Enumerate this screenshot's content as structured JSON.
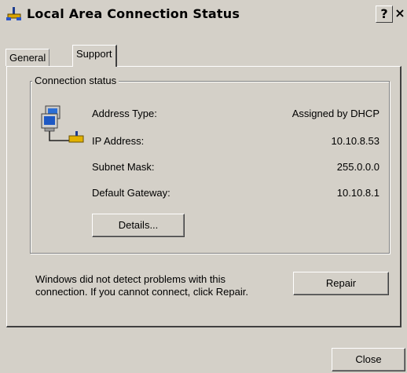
{
  "window": {
    "title": "Local Area Connection Status",
    "help_button": "?",
    "close_button": "×"
  },
  "tabs": [
    {
      "label": "General",
      "selected": false
    },
    {
      "label": "Support",
      "selected": true
    }
  ],
  "connection_status": {
    "group_label": "Connection status",
    "rows": [
      {
        "label": "Address Type:",
        "value": "Assigned by DHCP"
      },
      {
        "label": "IP Address:",
        "value": "10.10.8.53"
      },
      {
        "label": "Subnet Mask:",
        "value": "255.0.0.0"
      },
      {
        "label": "Default Gateway:",
        "value": "10.10.8.1"
      }
    ],
    "details_button": "Details..."
  },
  "repair_section": {
    "message": "Windows did not detect problems with this connection. If you cannot connect, click Repair.",
    "repair_button": "Repair"
  },
  "footer": {
    "close_button": "Close"
  },
  "icons": {
    "title_icon": "network-connection-icon",
    "status_icon": "network-computers-icon"
  }
}
